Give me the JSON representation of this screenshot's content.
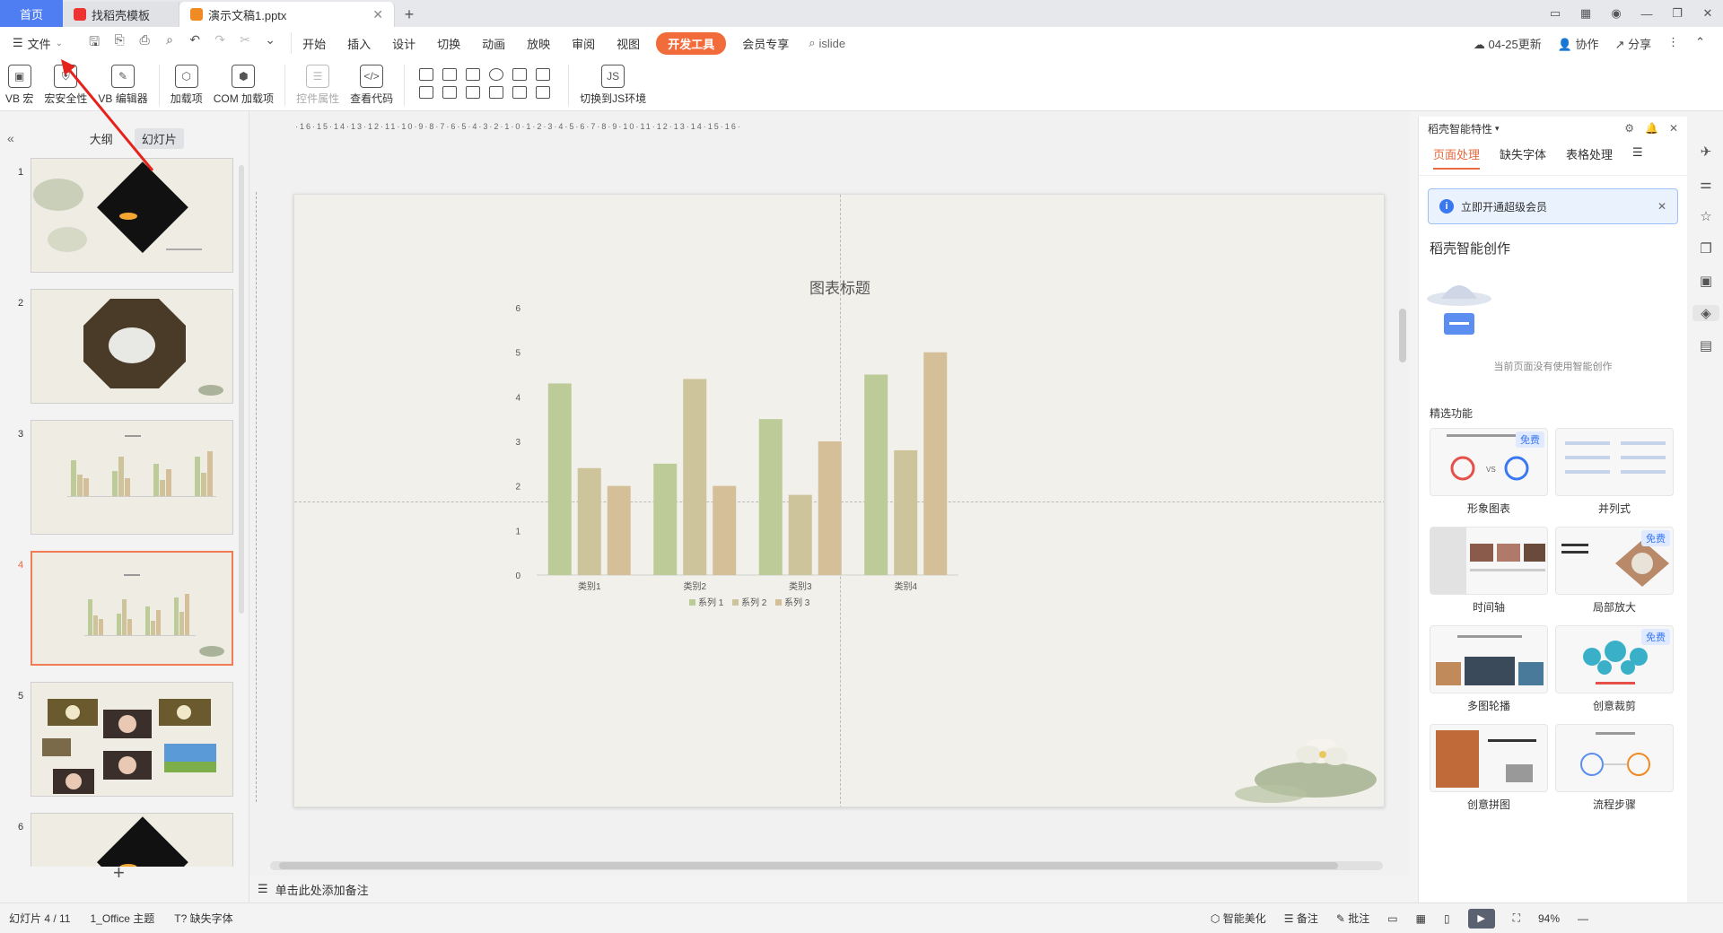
{
  "tabs": {
    "home": "首页",
    "template": "找稻壳模板",
    "document": "演示文稿1.pptx"
  },
  "menu": {
    "file": "文件",
    "items": [
      "开始",
      "插入",
      "设计",
      "切换",
      "动画",
      "放映",
      "审阅",
      "视图",
      "开发工具",
      "会员专享"
    ],
    "search": "islide",
    "update": "04-25更新",
    "collab": "协作",
    "share": "分享"
  },
  "toolbar": {
    "vb_macro": "VB 宏",
    "macro_security": "宏安全性",
    "vb_editor": "VB 编辑器",
    "addins": "加载项",
    "com_addins": "COM 加载项",
    "control_props": "控件属性",
    "view_code": "查看代码",
    "switch_js": "切换到JS环境"
  },
  "left_panel": {
    "tab_outline": "大纲",
    "tab_slides": "幻灯片",
    "slide_numbers": [
      "1",
      "2",
      "3",
      "4",
      "5",
      "6"
    ],
    "selected_slide": 4
  },
  "notes": {
    "placeholder": "单击此处添加备注"
  },
  "slide": {
    "chart_title": "图表标题"
  },
  "chart_data": {
    "type": "bar",
    "title": "图表标题",
    "categories": [
      "类别1",
      "类别2",
      "类别3",
      "类别4"
    ],
    "series": [
      {
        "name": "系列 1",
        "values": [
          4.3,
          2.5,
          3.5,
          4.5
        ],
        "color": "#bccb98"
      },
      {
        "name": "系列 2",
        "values": [
          2.4,
          4.4,
          1.8,
          2.8
        ],
        "color": "#cdc49b"
      },
      {
        "name": "系列 3",
        "values": [
          2.0,
          2.0,
          3.0,
          5.0
        ],
        "color": "#d4bf98"
      }
    ],
    "ylim": [
      0,
      6
    ],
    "yticks": [
      "0",
      "1",
      "2",
      "3",
      "4",
      "5",
      "6"
    ],
    "legend": "bottom",
    "grid": false
  },
  "right_pane": {
    "header": "稻壳智能特性",
    "tabs": [
      "页面处理",
      "缺失字体",
      "表格处理"
    ],
    "vip_banner": "立即开通超级会员",
    "section_title": "稻壳智能创作",
    "empty_text": "当前页面没有使用智能创作",
    "featured_label": "精选功能",
    "features": [
      {
        "label": "形象图表",
        "free": true
      },
      {
        "label": "并列式",
        "free": false
      },
      {
        "label": "时间轴",
        "free": false
      },
      {
        "label": "局部放大",
        "free": true
      },
      {
        "label": "多图轮播",
        "free": false
      },
      {
        "label": "创意裁剪",
        "free": true
      },
      {
        "label": "创意拼图",
        "free": false
      },
      {
        "label": "流程步骤",
        "free": false
      }
    ],
    "free_badge": "免费"
  },
  "status_bar": {
    "slide_count": "幻灯片 4 / 11",
    "theme": "1_Office 主题",
    "missing_font": "缺失字体",
    "beautify": "智能美化",
    "notes": "备注",
    "comments": "批注",
    "zoom": "94%"
  },
  "colors": {
    "accent": "#f26b3a",
    "home_tab": "#4f7ef2",
    "info_blue": "#3a78f2"
  }
}
